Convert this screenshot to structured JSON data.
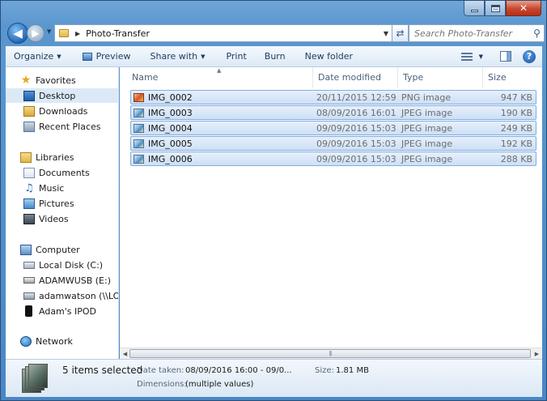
{
  "window": {
    "caption": {
      "minimize": "–",
      "maximize": "□",
      "close": "✕"
    }
  },
  "address_bar": {
    "path": "Photo-Transfer",
    "search_placeholder": "Search Photo-Transfer"
  },
  "toolbar": {
    "organize": "Organize",
    "preview": "Preview",
    "share_with": "Share with",
    "print": "Print",
    "burn": "Burn",
    "new_folder": "New folder",
    "help": "?"
  },
  "navigation": {
    "favorites": {
      "label": "Favorites",
      "items": [
        {
          "label": "Desktop",
          "selected": true
        },
        {
          "label": "Downloads"
        },
        {
          "label": "Recent Places"
        }
      ]
    },
    "libraries": {
      "label": "Libraries",
      "items": [
        {
          "label": "Documents"
        },
        {
          "label": "Music"
        },
        {
          "label": "Pictures"
        },
        {
          "label": "Videos"
        }
      ]
    },
    "computer": {
      "label": "Computer",
      "items": [
        {
          "label": "Local Disk (C:)"
        },
        {
          "label": "ADAMWUSB (E:)"
        },
        {
          "label": "adamwatson (\\\\LON"
        },
        {
          "label": "Adam's IPOD"
        }
      ]
    },
    "network": {
      "label": "Network"
    }
  },
  "file_list": {
    "columns": [
      "Name",
      "Date modified",
      "Type",
      "Size"
    ],
    "rows": [
      {
        "name": "IMG_0002",
        "date": "20/11/2015 12:59",
        "type": "PNG image",
        "size": "947 KB",
        "icon": "png-image-icon"
      },
      {
        "name": "IMG_0003",
        "date": "08/09/2016 16:01",
        "type": "JPEG image",
        "size": "190 KB",
        "icon": "jpeg-image-icon"
      },
      {
        "name": "IMG_0004",
        "date": "09/09/2016 15:03",
        "type": "JPEG image",
        "size": "249 KB",
        "icon": "jpeg-image-icon"
      },
      {
        "name": "IMG_0005",
        "date": "09/09/2016 15:03",
        "type": "JPEG image",
        "size": "192 KB",
        "icon": "jpeg-image-icon"
      },
      {
        "name": "IMG_0006",
        "date": "09/09/2016 15:03",
        "type": "JPEG image",
        "size": "288 KB",
        "icon": "jpeg-image-icon"
      }
    ]
  },
  "details": {
    "count": "5 items selected",
    "date_taken_label": "Date taken:",
    "date_taken_value": "08/09/2016 16:00 - 09/0...",
    "size_label": "Size:",
    "size_value": "1.81 MB",
    "dimensions_label": "Dimensions:",
    "dimensions_value": "(multiple values)"
  }
}
